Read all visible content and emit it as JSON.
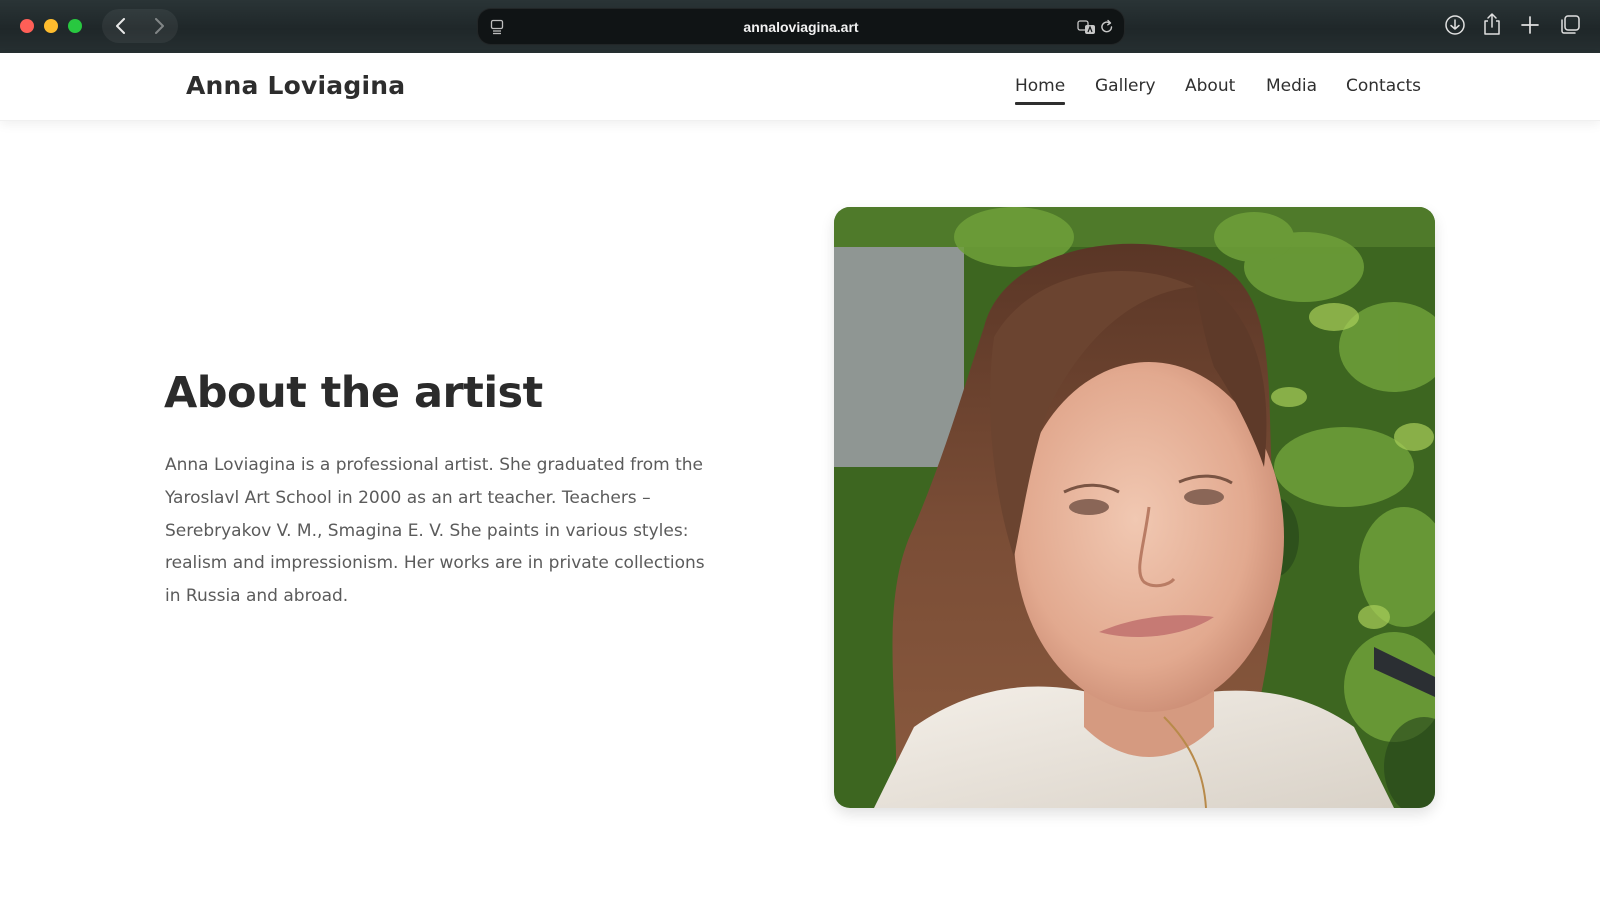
{
  "browser": {
    "url": "annaloviagina.art",
    "icons": {
      "close": "close-window",
      "minimize": "minimize-window",
      "maximize": "maximize-window",
      "back": "chevron-left-icon",
      "forward": "chevron-right-icon",
      "page_menu": "page-menu-icon",
      "translate": "translate-icon",
      "reload": "reload-icon",
      "download": "download-icon",
      "share": "share-icon",
      "new_tab": "plus-icon",
      "tab_overview": "tabs-icon"
    }
  },
  "site": {
    "logo": "Anna Loviagina",
    "nav": [
      {
        "label": "Home",
        "active": true
      },
      {
        "label": "Gallery",
        "active": false
      },
      {
        "label": "About",
        "active": false
      },
      {
        "label": "Media",
        "active": false
      },
      {
        "label": "Contacts",
        "active": false
      }
    ]
  },
  "about": {
    "title": "About the artist",
    "bio": "Anna Loviagina is a professional artist. She graduated from the Yaroslavl Art School in 2000 as an art teacher. Teachers – Serebryakov V. M., Smagina E. V. She paints in various styles: realism and impressionism. Her works are in private collections in Russia and abroad."
  },
  "colors": {
    "chrome_bg": "#1f2729",
    "address_bg": "#101415",
    "text_dark": "#2b2b2b",
    "text_body": "#5b5b5b",
    "foliage": "#3f6b22",
    "hair": "#6b4430"
  }
}
